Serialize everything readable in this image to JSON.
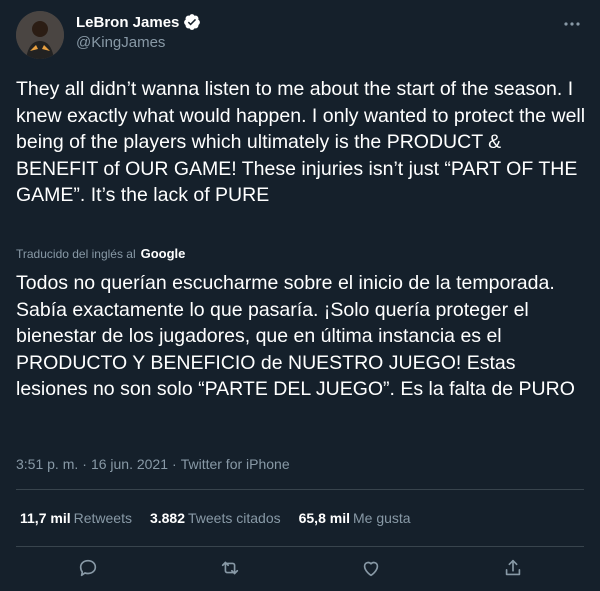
{
  "author": {
    "name": "LeBron James",
    "handle": "@KingJames",
    "avatar_icon": "avatar-photo"
  },
  "tweet": {
    "text": "They all didn’t wanna listen to me about the start of the season. I knew exactly what would happen. I only wanted to protect the well being of the players which ultimately is the PRODUCT & BENEFIT of OUR GAME! These injuries isn’t just “PART OF THE GAME”. It’s the lack of PURE",
    "translation_label": "Traducido del inglés al",
    "translation_provider": "Google",
    "translated_text": "Todos no querían escucharme sobre el inicio de la temporada. Sabía exactamente lo que pasaría. ¡Solo quería proteger el bienestar de los jugadores, que en última instancia es el PRODUCTO Y BENEFICIO de NUESTRO JUEGO! Estas lesiones no son solo “PARTE DEL JUEGO”. Es la falta de PURO",
    "time": "3:51 p. m.",
    "date": "16 jun. 2021",
    "source": "Twitter for iPhone"
  },
  "stats": {
    "retweets_count": "11,7 mil",
    "retweets_label": "Retweets",
    "quotes_count": "3.882",
    "quotes_label": "Tweets citados",
    "likes_count": "65,8 mil",
    "likes_label": "Me gusta"
  },
  "colors": {
    "background": "#15202b",
    "secondary_text": "#8899a6",
    "divider": "#38444d",
    "verified": "#ffffff"
  },
  "icons": [
    "verified-badge-icon",
    "more-icon",
    "reply-icon",
    "retweet-icon",
    "like-icon",
    "share-icon"
  ]
}
